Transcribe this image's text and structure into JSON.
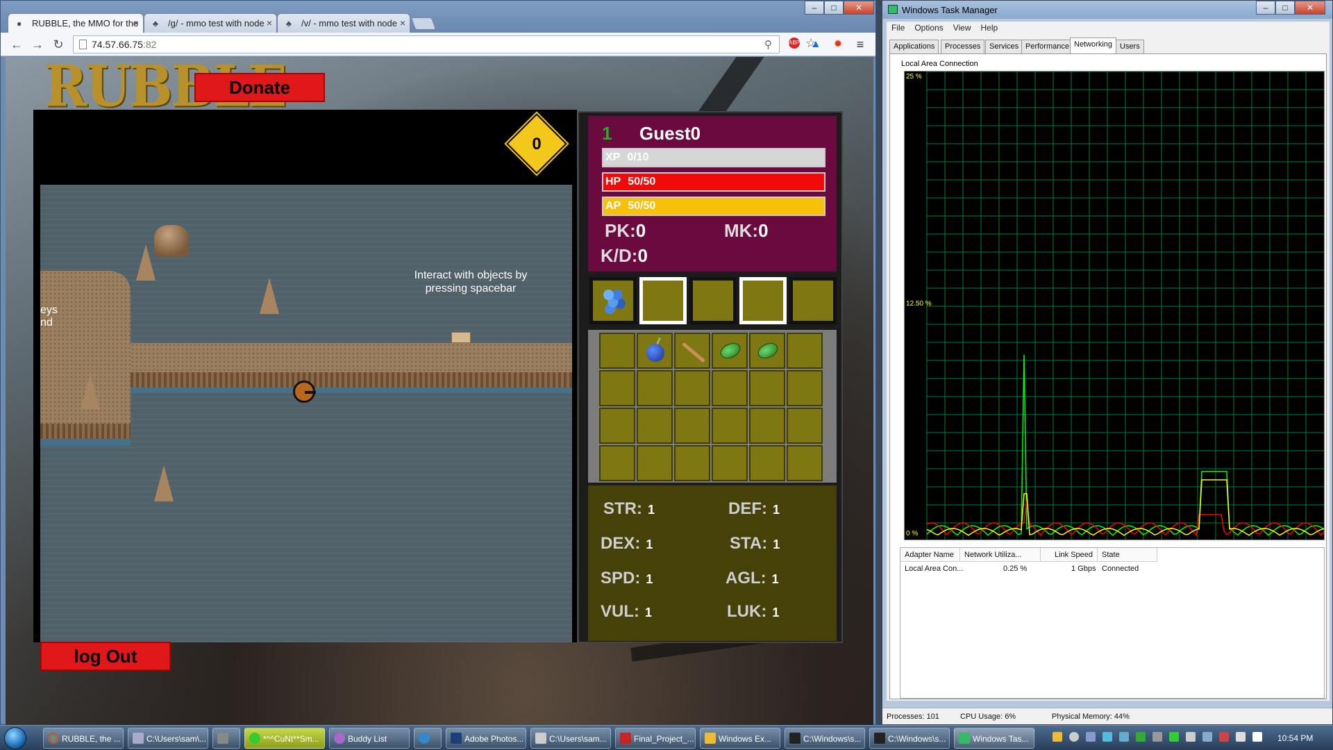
{
  "browser": {
    "tabs": [
      {
        "title": "RUBBLE, the MMO for the",
        "active": true
      },
      {
        "title": "/g/ - mmo test with node",
        "active": false
      },
      {
        "title": "/v/ - mmo test with node",
        "active": false
      }
    ],
    "url_host": "74.57.66.75",
    "url_port": ":82"
  },
  "game": {
    "logo": "RUBBLE",
    "donate_label": "Donate",
    "logout_label": "log Out",
    "counter": "0",
    "hint": "Interact with objects by pressing spacebar",
    "edge_hint_line1": "eys",
    "edge_hint_line2": "nd",
    "player": {
      "level": "1",
      "name": "Guest0",
      "xp_label": "XP",
      "xp_value": "0/10",
      "hp_label": "HP",
      "hp_value": "50/50",
      "ap_label": "AP",
      "ap_value": "50/50",
      "pk_label": "PK:",
      "pk_value": "0",
      "mk_label": "MK:",
      "mk_value": "0",
      "kd_label": "K/D:",
      "kd_value": "0"
    },
    "hotbar": [
      "grapes",
      "",
      "",
      "",
      ""
    ],
    "inventory_items": [
      "",
      "bomb",
      "stick",
      "leaf",
      "leaf",
      ""
    ],
    "attributes": [
      {
        "name": "STR:",
        "value": "1"
      },
      {
        "name": "DEF:",
        "value": "1"
      },
      {
        "name": "DEX:",
        "value": "1"
      },
      {
        "name": "STA:",
        "value": "1"
      },
      {
        "name": "SPD:",
        "value": "1"
      },
      {
        "name": "AGL:",
        "value": "1"
      },
      {
        "name": "VUL:",
        "value": "1"
      },
      {
        "name": "LUK:",
        "value": "1"
      }
    ],
    "colors": {
      "hp": "#f10a0a",
      "ap": "#f7c10a",
      "panel": "#6a0a3f",
      "slot": "#7f7812"
    }
  },
  "taskmgr": {
    "title": "Windows Task Manager",
    "menu": [
      "File",
      "Options",
      "View",
      "Help"
    ],
    "tabs": [
      "Applications",
      "Processes",
      "Services",
      "Performance",
      "Networking",
      "Users"
    ],
    "active_tab": "Networking",
    "graph_label": "Local Area Connection",
    "y_top": "25 %",
    "y_mid": "12.50 %",
    "y_bottom": "0 %",
    "columns": [
      "Adapter Name",
      "Network Utiliza...",
      "Link Speed",
      "State"
    ],
    "row": {
      "adapter": "Local Area Con...",
      "util": "0.25 %",
      "speed": "1 Gbps",
      "state": "Connected"
    },
    "status": {
      "processes": "Processes: 101",
      "cpu": "CPU Usage: 6%",
      "memory": "Physical Memory: 44%"
    },
    "colors": {
      "graph_bg": "#000000",
      "grid": "#008040",
      "line_total": "#ffff00",
      "line_sent": "#ff0000",
      "line_recv": "#00ff00"
    }
  },
  "taskbar": {
    "buttons": [
      "RUBBLE, the ...",
      "C:\\Users\\sam\\...",
      "",
      "*^^CuNt**Sm...",
      "Buddy List",
      "",
      "Adobe Photos...",
      "C:\\Users\\sam...",
      "Final_Project_...",
      "Windows Ex...",
      "C:\\Windows\\s...",
      "C:\\Windows\\s...",
      "Windows Tas..."
    ],
    "clock": "10:54 PM"
  }
}
